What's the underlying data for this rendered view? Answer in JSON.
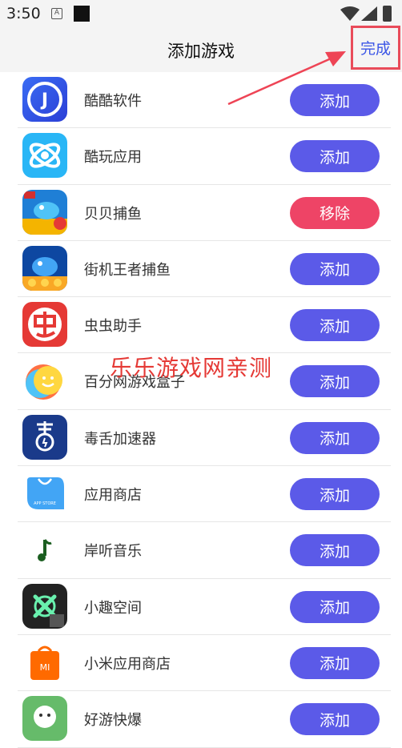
{
  "status_bar": {
    "time": "3:50",
    "a_icon_label": "A"
  },
  "header": {
    "title": "添加游戏",
    "done_label": "完成"
  },
  "watermark": "乐乐游戏网亲测",
  "apps": [
    {
      "name": "酷酷软件",
      "action": "添加",
      "icon": "kuku-j-icon",
      "state": "add"
    },
    {
      "name": "酷玩应用",
      "action": "添加",
      "icon": "kuwan-atom-icon",
      "state": "add"
    },
    {
      "name": "贝贝捕鱼",
      "action": "移除",
      "icon": "beibei-fish-icon",
      "state": "remove"
    },
    {
      "name": "街机王者捕鱼",
      "action": "添加",
      "icon": "jieji-fish-icon",
      "state": "add"
    },
    {
      "name": "虫虫助手",
      "action": "添加",
      "icon": "chongchong-icon",
      "state": "add"
    },
    {
      "name": "百分网游戏盒子",
      "action": "添加",
      "icon": "baifen-smile-icon",
      "state": "add"
    },
    {
      "name": "毒舌加速器",
      "action": "添加",
      "icon": "dushe-icon",
      "state": "add"
    },
    {
      "name": "应用商店",
      "action": "添加",
      "icon": "app-store-bag-icon",
      "state": "add"
    },
    {
      "name": "岸听音乐",
      "action": "添加",
      "icon": "music-note-icon",
      "state": "add"
    },
    {
      "name": "小趣空间",
      "action": "添加",
      "icon": "xiaoqu-x-icon",
      "state": "add"
    },
    {
      "name": "小米应用商店",
      "action": "添加",
      "icon": "mi-store-icon",
      "state": "add"
    },
    {
      "name": "好游快爆",
      "action": "添加",
      "icon": "haoyou-icon",
      "state": "add"
    }
  ],
  "colors": {
    "add_button": "#5b5ae8",
    "remove_button": "#ee4466",
    "done_border": "#e94b5a",
    "done_text": "#3b55e6",
    "watermark": "#e53935"
  }
}
